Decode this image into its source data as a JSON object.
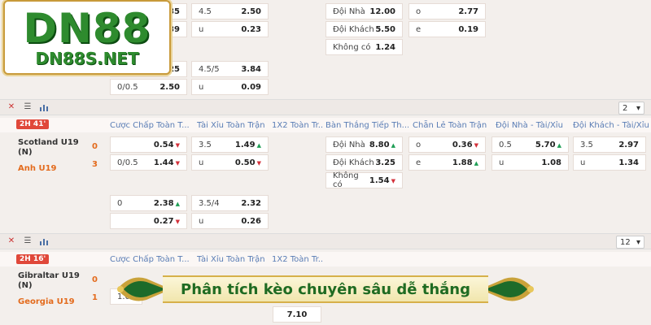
{
  "brand": {
    "name": "DN88",
    "url": "DN88S.NET"
  },
  "banner": {
    "text": "Phân tích kèo chuyên sâu dễ thắng"
  },
  "top_block": {
    "row1": [
      {
        "l": "",
        "v": "35"
      },
      {
        "l": "4.5",
        "v": "2.50"
      },
      {
        "l": "Đội Nhà",
        "v": "12.00"
      },
      {
        "l": "o",
        "v": "2.77"
      }
    ],
    "row2": [
      {
        "l": "",
        "v": "39"
      },
      {
        "l": "u",
        "v": "0.23"
      },
      {
        "l": "Đội Khách",
        "v": "5.50"
      },
      {
        "l": "e",
        "v": "0.19"
      }
    ],
    "row3": {
      "l": "Không có",
      "v": "1.24"
    },
    "row4": [
      {
        "l": "",
        "v": "25"
      },
      {
        "l": "4.5/5",
        "v": "3.84"
      }
    ],
    "row5": [
      {
        "l": "0/0.5",
        "v": "2.50"
      },
      {
        "l": "u",
        "v": "0.09"
      }
    ]
  },
  "match1": {
    "icons": [
      "close-icon",
      "list-icon",
      "stats-icon"
    ],
    "more_count": "2",
    "status": "2H 41'",
    "home": {
      "name": "Scotland U19 (N)",
      "score": "0"
    },
    "away": {
      "name": "Anh U19",
      "score": "3"
    },
    "headers": [
      "Cược Chấp Toàn T...",
      "Tài Xỉu Toàn Trận",
      "1X2 Toàn Tr...",
      "Bàn Thắng Tiếp Th...",
      "Chẵn Lẻ Toàn Trận",
      "Đội Nhà - Tài/Xỉu",
      "Đội Khách - Tài/Xỉu"
    ],
    "hcap": [
      {
        "l": "",
        "v": "0.54"
      },
      {
        "l": "0/0.5",
        "v": "1.44"
      },
      {
        "l": "0",
        "v": "2.38"
      },
      {
        "l": "",
        "v": "0.27"
      }
    ],
    "ou": [
      {
        "l": "3.5",
        "v": "1.49"
      },
      {
        "l": "u",
        "v": "0.50"
      },
      {
        "l": "3.5/4",
        "v": "2.32"
      },
      {
        "l": "u",
        "v": "0.26"
      }
    ],
    "next_goal": [
      {
        "l": "Đội Nhà",
        "v": "8.80"
      },
      {
        "l": "Đội Khách",
        "v": "3.25"
      },
      {
        "l": "Không có",
        "v": "1.54"
      }
    ],
    "odd_even": [
      {
        "l": "o",
        "v": "0.36"
      },
      {
        "l": "e",
        "v": "1.88"
      }
    ],
    "home_ou": [
      {
        "l": "0.5",
        "v": "5.70"
      },
      {
        "l": "u",
        "v": "1.08"
      }
    ],
    "away_ou": [
      {
        "l": "3.5",
        "v": "2.97"
      },
      {
        "l": "u",
        "v": "1.34"
      }
    ]
  },
  "match2": {
    "more_count": "12",
    "status": "2H 16'",
    "home": {
      "name": "Gibraltar U19 (N)",
      "score": "0"
    },
    "away": {
      "name": "Georgia U19",
      "score": "1"
    },
    "headers": [
      "Cược Chấp Toàn T...",
      "Tài Xỉu Toàn Trận",
      "1X2 Toàn Tr..."
    ],
    "hcap_value": "1.0",
    "x2_value": "7.10"
  },
  "colors": {
    "accent": "#e0483a",
    "header_text": "#5a7db5",
    "team_away": "#e36b1d",
    "logo_green": "#2e8b2e",
    "banner_bg": "#f7f0c8"
  }
}
